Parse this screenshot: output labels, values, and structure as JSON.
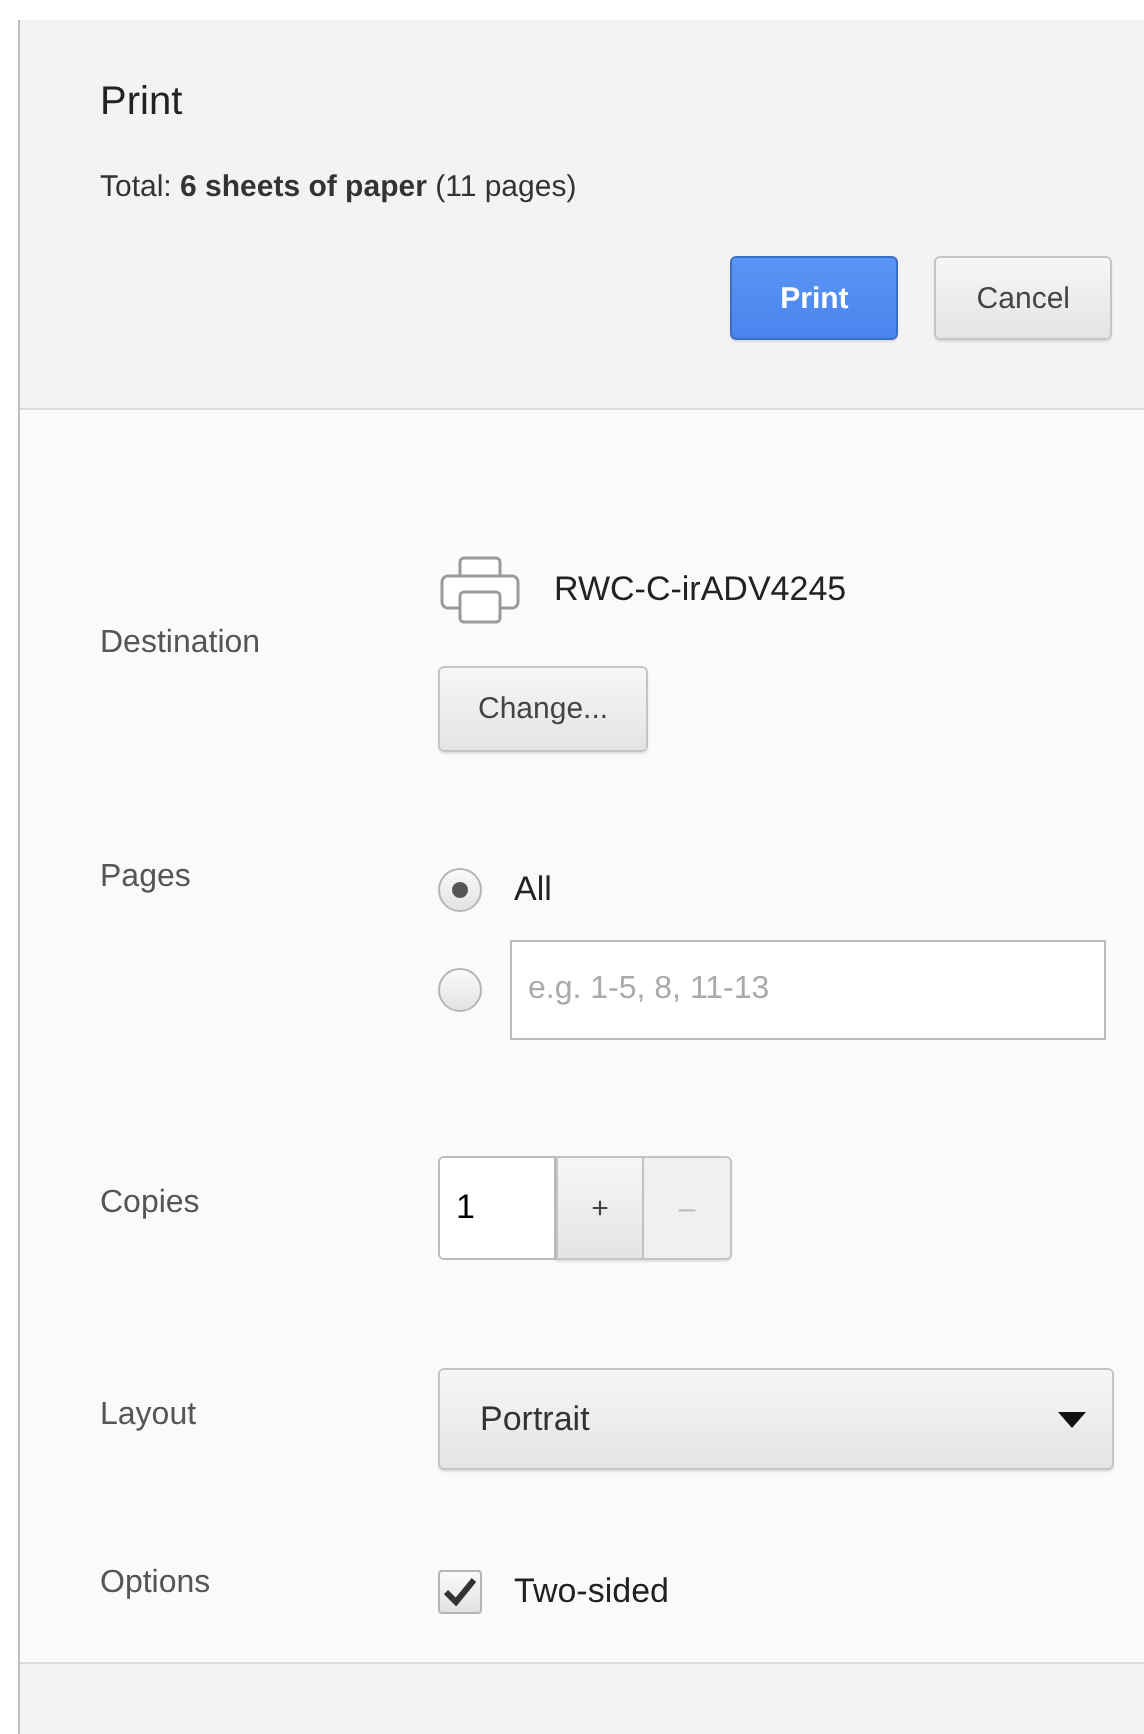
{
  "header": {
    "title": "Print",
    "total": "Total: **6 sheets of paper** (11 pages)",
    "buttons": [
      {
        "label": "Print",
        "kind": "primary"
      },
      {
        "label": "Cancel",
        "kind": "secondary"
      }
    ]
  },
  "settings": [
    {
      "kind": "destination",
      "label": "Destination",
      "printer": "RWC-C-irADV4245",
      "button": "Change..."
    },
    {
      "kind": "pages",
      "label": "Pages",
      "options": [
        {
          "label": "All",
          "selected": true
        },
        {
          "placeholder": "e.g. 1-5, 8, 11-13",
          "selected": false
        }
      ]
    },
    {
      "kind": "copies",
      "label": "Copies",
      "value": "1",
      "plus": "+",
      "minus": "–",
      "minus_disabled": true
    },
    {
      "kind": "select",
      "label": "Layout",
      "value": "Portrait"
    },
    {
      "kind": "checkbox",
      "label": "Options",
      "option": "Two-sided",
      "checked": true
    }
  ]
}
